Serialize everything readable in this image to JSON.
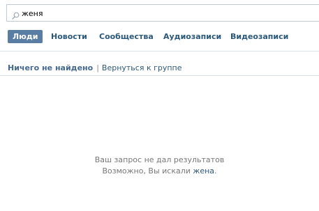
{
  "search": {
    "value": "женя",
    "icon": "search-icon"
  },
  "tabs": [
    {
      "label": "Люди",
      "active": true
    },
    {
      "label": "Новости",
      "active": false
    },
    {
      "label": "Сообщества",
      "active": false
    },
    {
      "label": "Аудиозаписи",
      "active": false
    },
    {
      "label": "Видеозаписи",
      "active": false
    }
  ],
  "summary": {
    "title": "Ничего не найдено",
    "separator": "|",
    "back_link": "Вернуться к группе"
  },
  "empty": {
    "line1": "Ваш запрос не дал результатов",
    "line2_prefix": "Возможно, Вы искали ",
    "suggestion": "жена",
    "line2_suffix": "."
  },
  "colors": {
    "accent": "#597da3",
    "link": "#2b587a",
    "muted_text": "#777777",
    "divider": "#dae1e8"
  }
}
